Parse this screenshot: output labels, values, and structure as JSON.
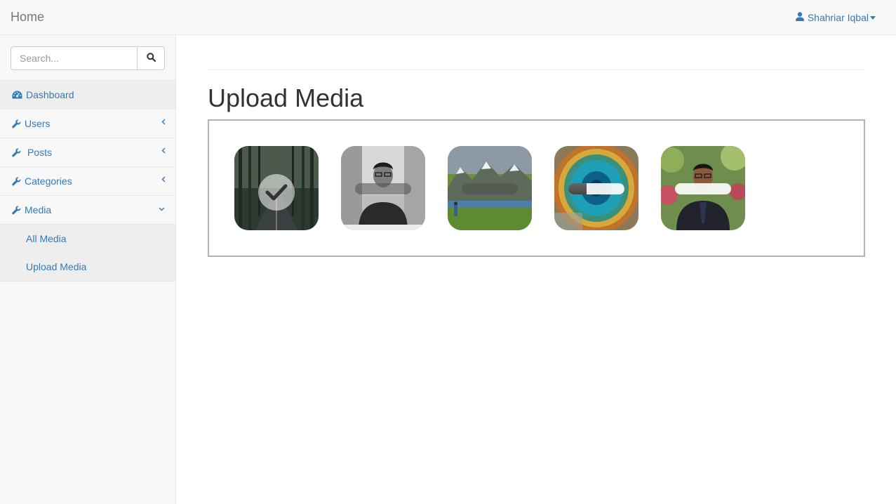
{
  "navbar": {
    "brand": "Home",
    "user_name": "Shahriar Iqbal"
  },
  "sidebar": {
    "search_placeholder": "Search...",
    "items": [
      {
        "label": "Dashboard",
        "icon": "dashboard-icon"
      },
      {
        "label": "Users",
        "icon": "wrench-icon"
      },
      {
        "label": "Posts",
        "icon": "wrench-icon"
      },
      {
        "label": "Categories",
        "icon": "wrench-icon"
      },
      {
        "label": "Media",
        "icon": "wrench-icon"
      }
    ],
    "media_submenu": [
      "All Media",
      "Upload Media"
    ]
  },
  "main": {
    "title": "Upload Media",
    "previews": [
      {
        "subject": "forest road",
        "status": "complete",
        "progress": 1.0
      },
      {
        "subject": "portrait black and white",
        "status": "uploading",
        "progress": 0.0
      },
      {
        "subject": "mountain lake landscape",
        "status": "uploading",
        "progress": 0.0
      },
      {
        "subject": "turquoise hot spring",
        "status": "uploading",
        "progress": 0.33
      },
      {
        "subject": "portrait in garden",
        "status": "uploading",
        "progress": 0.0
      }
    ]
  },
  "colors": {
    "link": "#337ab7",
    "navbar_bg": "#f8f8f8",
    "submenu_bg": "#eeeeee"
  }
}
